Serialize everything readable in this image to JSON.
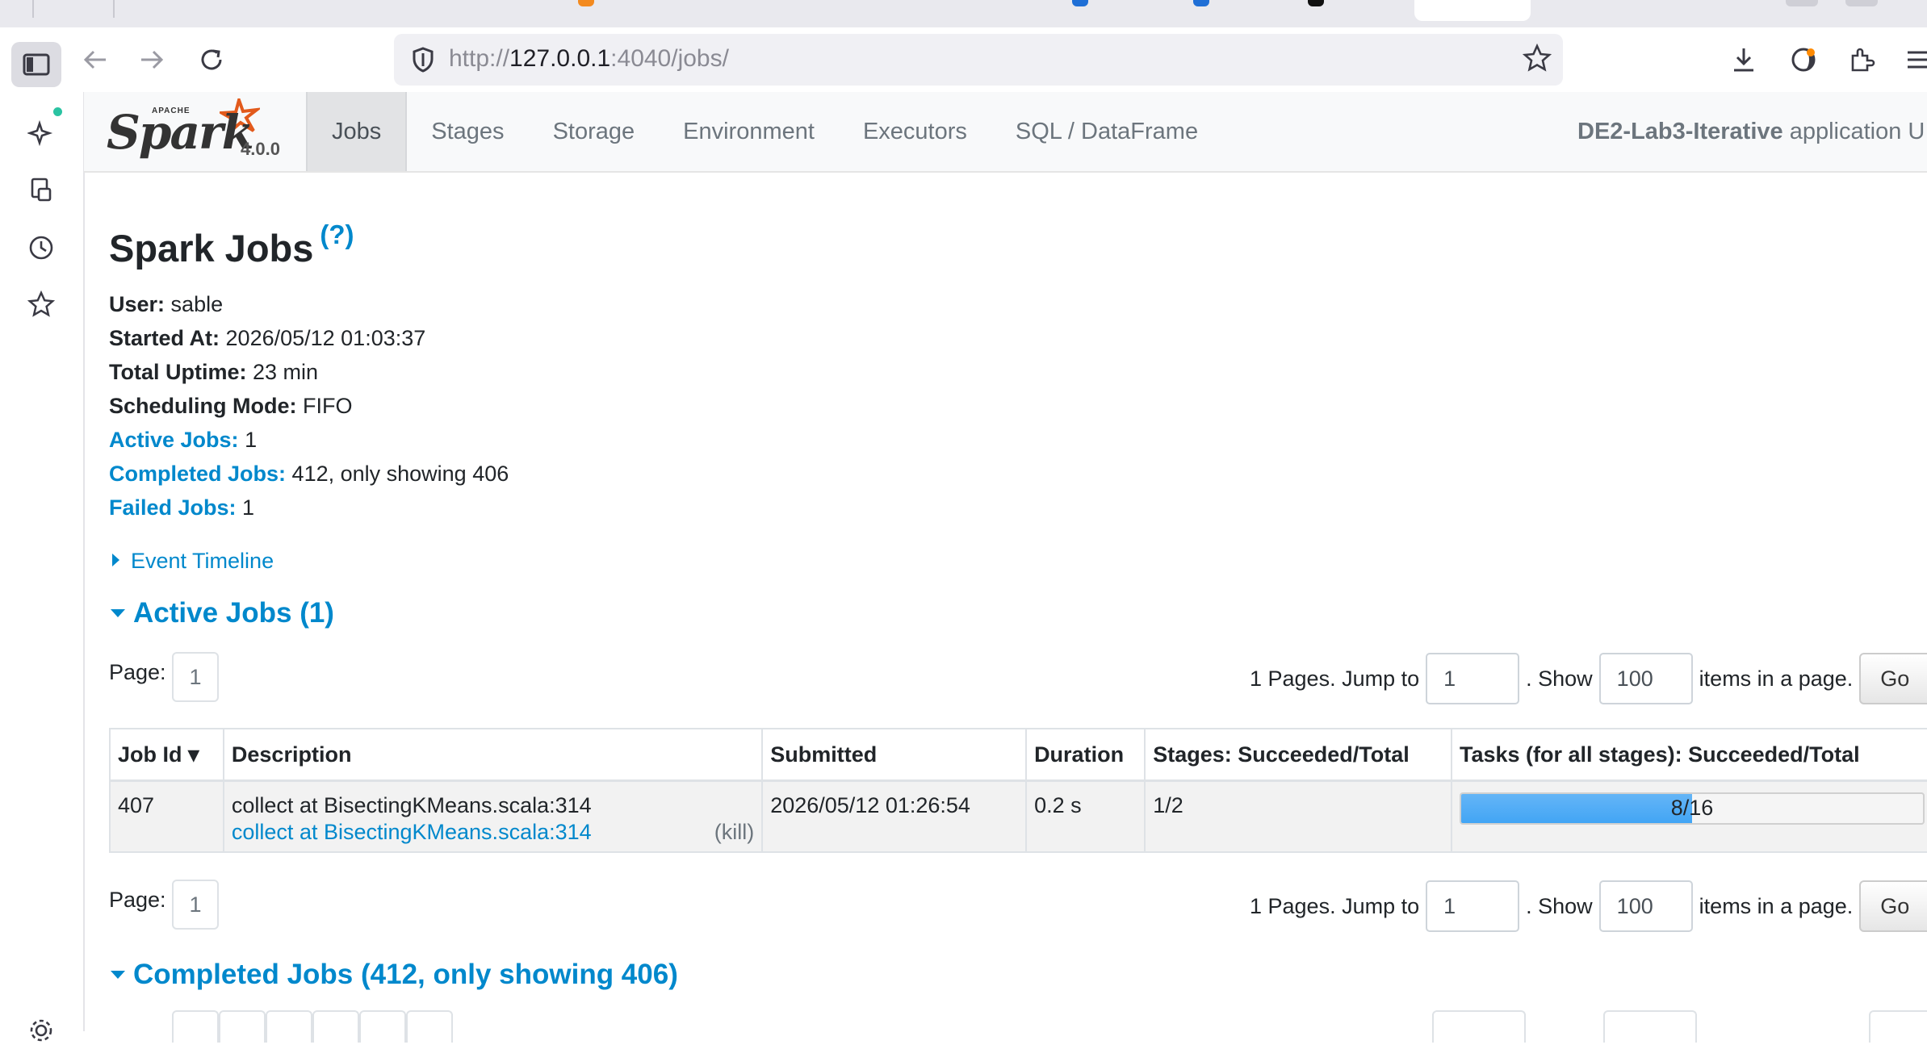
{
  "browser": {
    "url_prefix": "http://",
    "url_host": "127.0.0.1",
    "url_rest": ":4040/jobs/"
  },
  "navbar": {
    "logo_small": "APACHE",
    "logo_word": "Spark",
    "version": "4.0.0",
    "tabs": [
      "Jobs",
      "Stages",
      "Storage",
      "Environment",
      "Executors",
      "SQL / DataFrame"
    ],
    "active_tab": "Jobs",
    "app_name": "DE2-Lab3-Iterative",
    "app_suffix": "application U"
  },
  "page": {
    "title": "Spark Jobs",
    "help": "(?)",
    "summary": {
      "user_label": "User:",
      "user": "sable",
      "started_label": "Started At:",
      "started": "2026/05/12 01:03:37",
      "uptime_label": "Total Uptime:",
      "uptime": "23 min",
      "mode_label": "Scheduling Mode:",
      "mode": "FIFO",
      "active_label": "Active Jobs:",
      "active": "1",
      "completed_label": "Completed Jobs:",
      "completed": "412, only showing 406",
      "failed_label": "Failed Jobs:",
      "failed": "1"
    },
    "event_timeline": "Event Timeline",
    "active_section": "Active Jobs (1)",
    "completed_section": "Completed Jobs (412, only showing 406)"
  },
  "pager": {
    "page_label": "Page:",
    "current_page": "1",
    "pages_text": "1 Pages. Jump to",
    "jump_value": "1",
    "show_text": ". Show",
    "show_value": "100",
    "items_text": "items in a page.",
    "go_label": "Go"
  },
  "table": {
    "headers": [
      "Job Id ▾",
      "Description",
      "Submitted",
      "Duration",
      "Stages: Succeeded/Total",
      "Tasks (for all stages): Succeeded/Total"
    ],
    "rows": [
      {
        "job_id": "407",
        "desc_main": "collect at BisectingKMeans.scala:314",
        "desc_link": "collect at BisectingKMeans.scala:314",
        "kill": "(kill)",
        "submitted": "2026/05/12 01:26:54",
        "duration": "0.2 s",
        "stages": "1/2",
        "tasks_text": "8/16",
        "tasks_fraction": 0.5
      }
    ]
  },
  "colors": {
    "link": "#0088cc",
    "progress": "#42a5f5"
  }
}
